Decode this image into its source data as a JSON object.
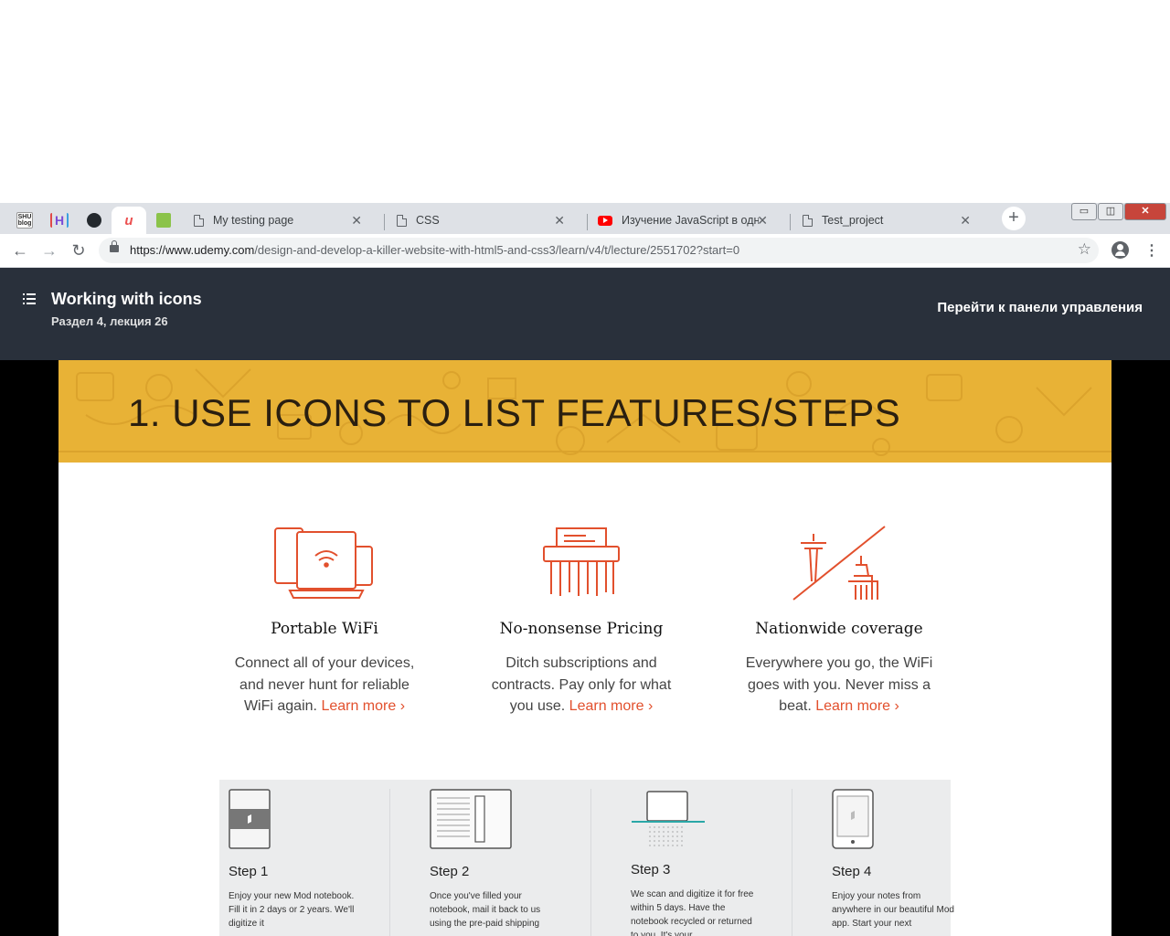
{
  "browser": {
    "pinned_tabs": [
      {
        "name": "shu-blog",
        "label": "SHU blog",
        "color": "#2b2b2b"
      },
      {
        "name": "h-extension",
        "label": "H",
        "color": "#7b4bd6"
      },
      {
        "name": "github",
        "label": "github",
        "color": "#24292e"
      },
      {
        "name": "udemy",
        "label": "u",
        "color": "#ec5252"
      },
      {
        "name": "extension",
        "label": "",
        "color": "#8bc34a"
      }
    ],
    "tabs": [
      {
        "title": "My testing page",
        "icon": "page-icon"
      },
      {
        "title": "CSS",
        "icon": "page-icon"
      },
      {
        "title": "Изучение JavaScript в одном",
        "icon": "youtube-icon"
      },
      {
        "title": "Test_project",
        "icon": "page-icon"
      }
    ],
    "tab_close": "✕",
    "new_tab": "+",
    "window_controls": {
      "minimize": "▭",
      "restore": "◫",
      "close": "✕"
    },
    "nav": {
      "back": "←",
      "forward": "→",
      "reload": "↻"
    },
    "url_host": "https://www.udemy.com",
    "url_path": "/design-and-develop-a-killer-website-with-html5-and-css3/learn/v4/t/lecture/2551702?start=0",
    "bookmark_star": "☆",
    "menu": "⋮"
  },
  "lecture_header": {
    "title": "Working with icons",
    "subtitle": "Раздел 4, лекция 26",
    "dashboard_link": "Перейти к панели управления"
  },
  "slide": {
    "banner_title": "1. USE ICONS TO LIST FEATURES/STEPS",
    "features": [
      {
        "title": "Portable WiFi",
        "text": "Connect all of your devices, and never hunt for reliable WiFi again.",
        "link": "Learn more ›"
      },
      {
        "title": "No-nonsense Pricing",
        "text": "Ditch subscriptions and contracts. Pay only for what you use.",
        "link": "Learn more ›"
      },
      {
        "title": "Nationwide coverage",
        "text": "Everywhere you go, the WiFi goes with you. Never miss a beat.",
        "link": "Learn more ›"
      }
    ],
    "accent_color": "#e2502d",
    "banner_color": "#e8b236",
    "steps": [
      {
        "title": "Step 1",
        "text": "Enjoy your new Mod notebook. Fill it in 2 days or 2 years. We'll digitize it"
      },
      {
        "title": "Step 2",
        "text": "Once you've filled your notebook, mail it back to us using the pre-paid shipping"
      },
      {
        "title": "Step 3",
        "text": "We scan and digitize it for free within 5 days. Have the notebook recycled or returned to you. It's your"
      },
      {
        "title": "Step 4",
        "text": "Enjoy your notes from anywhere in our beautiful Mod app. Start your next"
      }
    ]
  }
}
